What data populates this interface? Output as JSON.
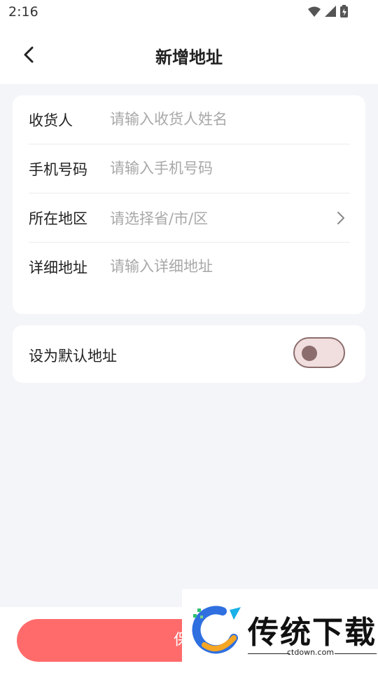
{
  "status_bar": {
    "time": "2:16"
  },
  "header": {
    "title": "新增地址"
  },
  "form": {
    "receiver": {
      "label": "收货人",
      "placeholder": "请输入收货人姓名"
    },
    "phone": {
      "label": "手机号码",
      "placeholder": "请输入手机号码"
    },
    "region": {
      "label": "所在地区",
      "placeholder": "请选择省/市/区"
    },
    "detail": {
      "label": "详细地址",
      "placeholder": "请输入详细地址"
    }
  },
  "default_address": {
    "label": "设为默认地址",
    "enabled": false
  },
  "footer": {
    "save_label": "保存"
  },
  "watermark": {
    "brand": "传统下载",
    "url": "ctdown.com"
  },
  "colors": {
    "accent": "#ff6b6b",
    "toggle_border": "#8c6d6d",
    "toggle_bg": "#f1dede",
    "page_bg": "#f4f5f9"
  },
  "icons": {
    "back": "chevron-left-icon",
    "region_arrow": "chevron-right-icon",
    "wifi": "wifi-icon",
    "signal": "signal-icon",
    "battery": "battery-icon"
  }
}
